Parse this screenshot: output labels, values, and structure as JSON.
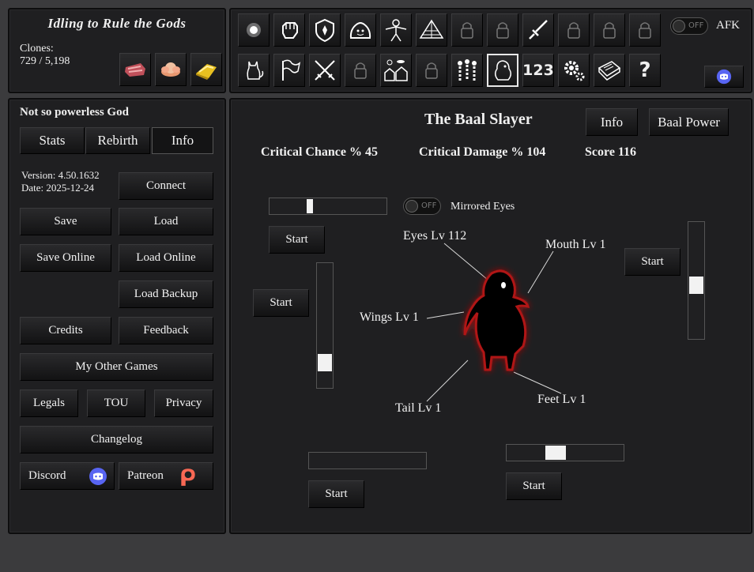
{
  "app_title": "Idling to Rule the Gods",
  "clones": {
    "label": "Clones:",
    "value": "729 / 5,198"
  },
  "afk": {
    "toggle": "OFF",
    "label": "AFK"
  },
  "god": {
    "title": "Not so powerless God",
    "tabs": [
      "Stats",
      "Rebirth",
      "Info"
    ],
    "version": "Version: 4.50.1632",
    "date": "Date: 2025-12-24",
    "buttons": {
      "connect": "Connect",
      "save": "Save",
      "load": "Load",
      "save_online": "Save Online",
      "load_online": "Load Online",
      "load_backup": "Load Backup",
      "credits": "Credits",
      "feedback": "Feedback",
      "other_games": "My Other Games",
      "legals": "Legals",
      "tou": "TOU",
      "privacy": "Privacy",
      "changelog": "Changelog",
      "discord": "Discord",
      "patreon": "Patreon"
    }
  },
  "baal": {
    "title": "The Baal Slayer",
    "info": "Info",
    "power": "Baal Power",
    "crit_chance": "Critical Chance % 45",
    "crit_damage": "Critical Damage % 104",
    "score": "Score 116",
    "mirrored_toggle": "OFF",
    "mirrored_label": "Mirrored Eyes",
    "start": "Start",
    "parts": {
      "eyes": "Eyes Lv 112",
      "mouth": "Mouth Lv 1",
      "wings": "Wings Lv 1",
      "tail": "Tail Lv 1",
      "feet": "Feet Lv 1"
    },
    "sliders": {
      "top_h": 0.33,
      "left_v": 0.15,
      "right_v": 0.45,
      "bottom_left_h": 0.0,
      "bottom_right_h": 0.4
    }
  },
  "colors": {
    "panel": "#1f1f21",
    "background": "#3b3b3d",
    "glow": "#c01010",
    "discord": "#5865f2",
    "patreon": "#f96854"
  },
  "toolbar_text": {
    "numbers": "123",
    "help": "?"
  }
}
